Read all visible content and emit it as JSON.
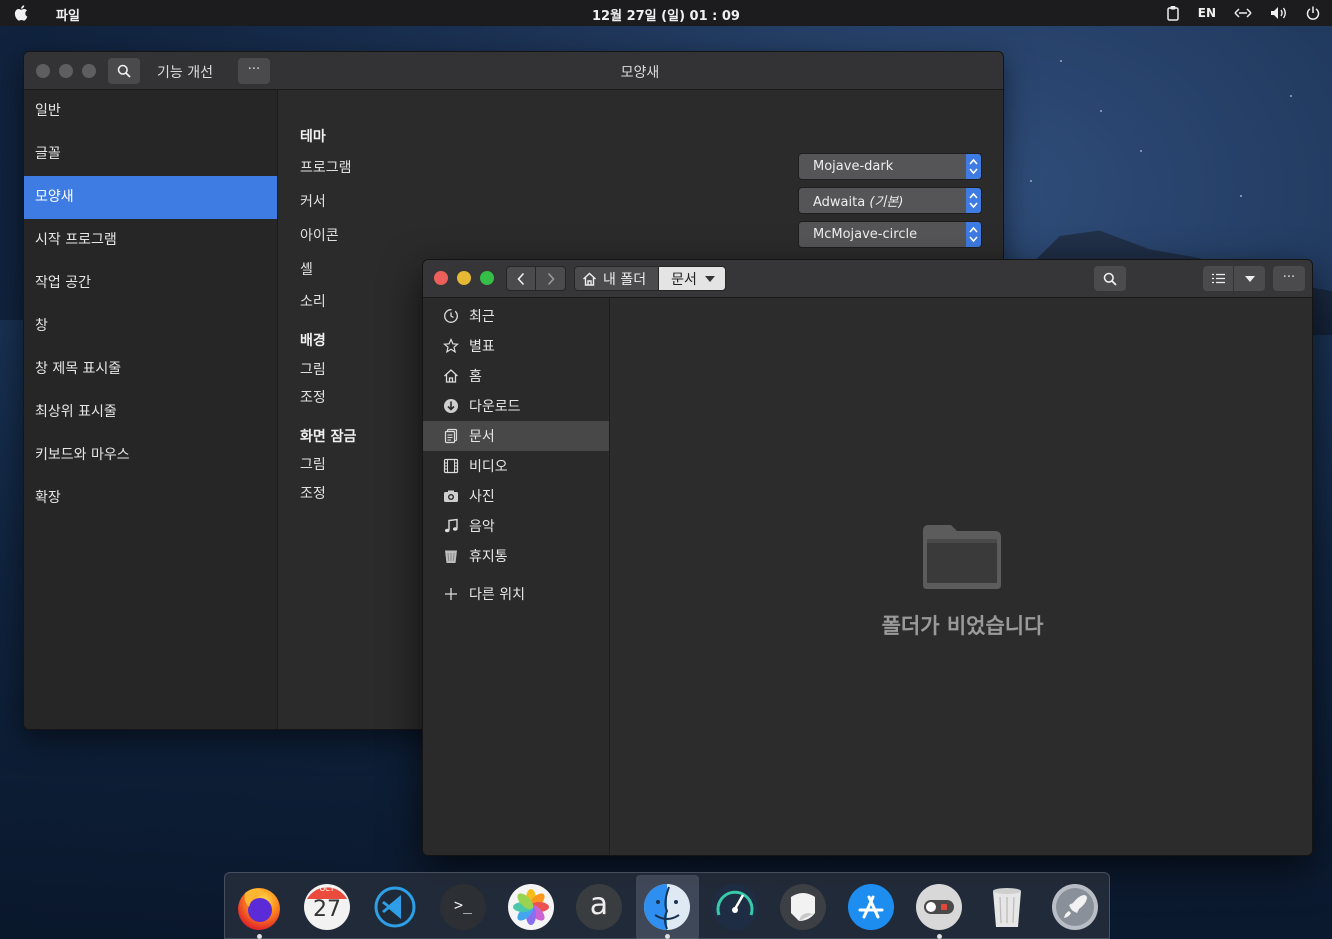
{
  "topbar": {
    "app_menu": "파일",
    "clock": "12월 27일 (일) 01 : 09",
    "lang": "EN",
    "tray_icons": [
      "clipboard-icon",
      "network-icon",
      "volume-icon",
      "power-icon"
    ]
  },
  "settings": {
    "search_tooltip": "search-icon",
    "left_title": "기능 개선",
    "more_label": "···",
    "title": "모양새",
    "sidebar": [
      {
        "label": "일반"
      },
      {
        "label": "글꼴"
      },
      {
        "label": "모양새",
        "active": true
      },
      {
        "label": "시작 프로그램"
      },
      {
        "label": "작업 공간"
      },
      {
        "label": "창"
      },
      {
        "label": "창 제목 표시줄"
      },
      {
        "label": "최상위 표시줄"
      },
      {
        "label": "키보드와 마우스"
      },
      {
        "label": "확장"
      }
    ],
    "theme": {
      "title": "테마",
      "program_label": "프로그램",
      "program_value": "Mojave-dark",
      "cursor_label": "커서",
      "cursor_value": "Adwaita",
      "cursor_default": "(기본)",
      "icon_label": "아이콘",
      "icon_value": "McMojave-circle",
      "shell_label": "셸",
      "sound_label": "소리"
    },
    "background": {
      "title": "배경",
      "picture_label": "그림",
      "adjust_label": "조정"
    },
    "lockscreen": {
      "title": "화면 잠금",
      "picture_label": "그림",
      "adjust_label": "조정"
    }
  },
  "files": {
    "path_home": "내 폴더",
    "path_current": "문서",
    "more_label": "···",
    "places": [
      {
        "label": "최근",
        "icon": "recent-icon"
      },
      {
        "label": "별표",
        "icon": "star-icon"
      },
      {
        "label": "홈",
        "icon": "home-icon"
      },
      {
        "label": "다운로드",
        "icon": "download-icon"
      },
      {
        "label": "문서",
        "icon": "documents-icon",
        "active": true
      },
      {
        "label": "비디오",
        "icon": "video-icon"
      },
      {
        "label": "사진",
        "icon": "camera-icon"
      },
      {
        "label": "음악",
        "icon": "music-icon"
      },
      {
        "label": "휴지통",
        "icon": "trash-icon"
      }
    ],
    "other_locations": "다른 위치",
    "empty_message": "폴더가 비었습니다"
  },
  "dock": {
    "apps": [
      "firefox",
      "calendar",
      "vscode",
      "terminal",
      "photos",
      "appcenter",
      "finder",
      "system-monitor",
      "sticky-notes",
      "app-store",
      "tweaks-toggle",
      "trash",
      "launchpad"
    ],
    "calendar_month": "OCT",
    "calendar_day": "27",
    "terminal_glyph": ">_",
    "appcenter_glyph": "a"
  },
  "colors": {
    "accent": "#3e7be3",
    "close": "#ec5f5a",
    "minimize": "#e6b934",
    "maximize": "#35bf47"
  }
}
